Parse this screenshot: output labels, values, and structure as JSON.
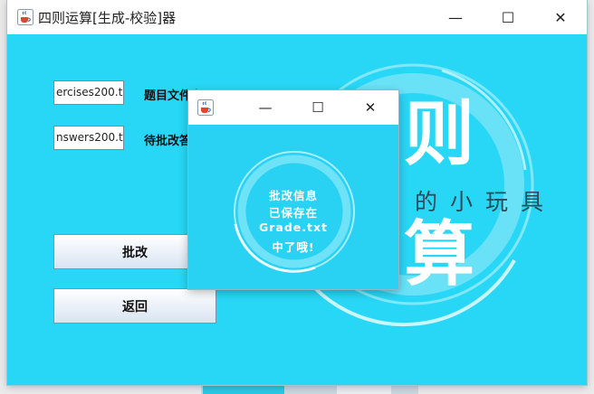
{
  "window": {
    "title": "四则运算[生成-校验]器",
    "minimize_glyph": "—",
    "maximize_glyph": "☐",
    "close_glyph": "✕"
  },
  "form": {
    "exercise_file_value": "ercises200.txt",
    "exercise_file_label": "题目文件名",
    "answer_file_value": "nswers200.txt",
    "answer_file_label": "待批改答案",
    "grade_button": "批改",
    "back_button": "返回"
  },
  "background": {
    "char_top": "则",
    "char_bottom": "算",
    "tagline": "的小玩具"
  },
  "dialog": {
    "message_lines": [
      "批改信息",
      "已保存在",
      "Grade.txt",
      "中了哦!"
    ]
  },
  "icons": {
    "app": "java-cup-icon",
    "minimize": "minimize-icon",
    "maximize": "maximize-icon",
    "close": "close-icon"
  },
  "colors": {
    "accent": "#28d7f6",
    "titlebar": "#ffffff",
    "ring": "#bff4ff"
  }
}
